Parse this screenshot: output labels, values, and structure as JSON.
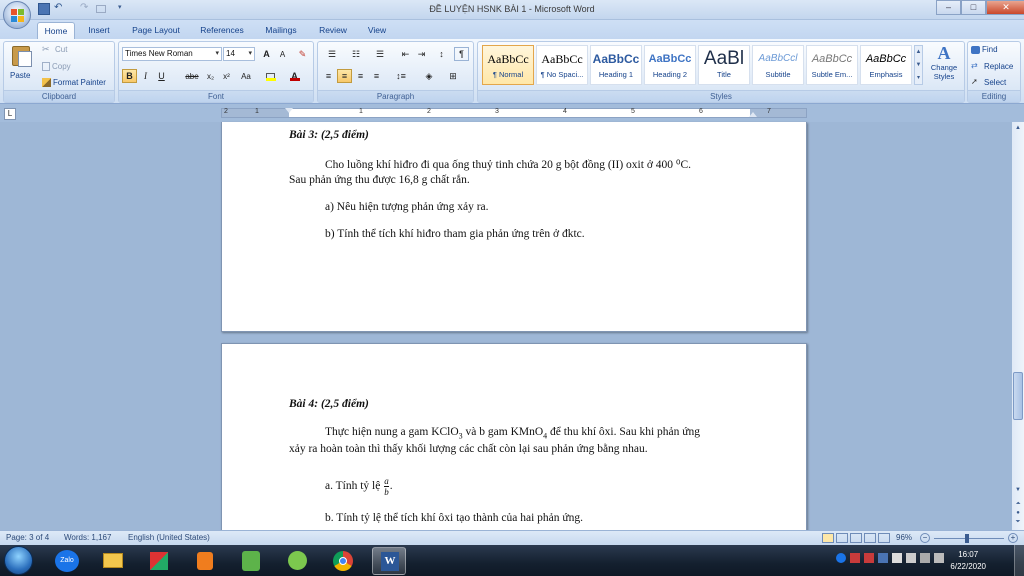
{
  "window": {
    "title": "ĐỀ LUYỆN HSNK BÀI 1 - Microsoft Word",
    "controls": {
      "minimize": "–",
      "maximize": "□",
      "close": "✕"
    }
  },
  "tabs": [
    {
      "label": "Home",
      "active": true
    },
    {
      "label": "Insert"
    },
    {
      "label": "Page Layout"
    },
    {
      "label": "References"
    },
    {
      "label": "Mailings"
    },
    {
      "label": "Review"
    },
    {
      "label": "View"
    }
  ],
  "clipboard": {
    "group_label": "Clipboard",
    "paste": "Paste",
    "cut": "Cut",
    "copy": "Copy",
    "format_painter": "Format Painter"
  },
  "font": {
    "group_label": "Font",
    "family": "Times New Roman",
    "size": "14",
    "grow": "A",
    "shrink": "A",
    "bold": "B",
    "italic": "I",
    "underline": "U",
    "strike": "abe",
    "subscript": "x₂",
    "superscript": "x²",
    "change_case": "Aa",
    "highlight_color": "#ffff00",
    "font_color": "#c00000"
  },
  "paragraph": {
    "group_label": "Paragraph",
    "pilcrow": "¶"
  },
  "styles": {
    "group_label": "Styles",
    "items": [
      {
        "sample": "AaBbCc",
        "name": "¶ Normal",
        "selected": true
      },
      {
        "sample": "AaBbCc",
        "name": "¶ No Spaci..."
      },
      {
        "sample": "AaBbCc",
        "name": "Heading 1"
      },
      {
        "sample": "AaBbCc",
        "name": "Heading 2"
      },
      {
        "sample": "AaBl",
        "name": "Title"
      },
      {
        "sample": "AaBbCcl",
        "name": "Subtitle"
      },
      {
        "sample": "AaBbCc",
        "name": "Subtle Em..."
      },
      {
        "sample": "AaBbCc",
        "name": "Emphasis"
      }
    ],
    "change_styles": "Change Styles"
  },
  "editing": {
    "group_label": "Editing",
    "find": "Find",
    "replace": "Replace",
    "select": "Select"
  },
  "ruler": {
    "numbers": [
      "1",
      "2",
      "1",
      "2",
      "3",
      "4",
      "5",
      "6",
      "7"
    ]
  },
  "page1": {
    "heading": "Bài 3: (2,5 điểm)",
    "line1": "Cho luồng khí hiđro đi qua ống thuỷ tinh chứa 20 g bột đồng (II) oxit  ở 400 ⁰C.",
    "line2": "Sau phản ứng thu được 16,8 g chất rắn.",
    "q_a": "a) Nêu hiện tượng phản ứng xảy ra.",
    "q_b": "b) Tính thể tích khí hiđro tham gia phản ứng trên ở đktc."
  },
  "page2": {
    "heading": "Bài 4: (2,5 điểm)",
    "line1_start": "Thực hiện nung a gam KClO",
    "sub3": "3",
    "line1_mid": " và b gam KMnO",
    "sub4": "4",
    "line1_end": " để thu khí ôxi. Sau khi phản ứng",
    "line2": "xảy ra hoàn toàn thì thấy khối lượng các chất còn lại sau phản ứng bằng nhau.",
    "q_a_prefix": "a. Tính tỷ lệ ",
    "frac_num": "a",
    "frac_den": "b",
    "q_a_suffix": ".",
    "q_b": "b. Tính tỷ lệ thể tích khí ôxi tạo thành của hai phản ứng."
  },
  "status": {
    "page": "Page: 3 of 4",
    "words": "Words: 1,167",
    "language": "English (United States)",
    "zoom": "96%"
  },
  "taskbar": {
    "zalo_label": "Zalo",
    "time": "16:07",
    "date": "6/22/2020"
  }
}
